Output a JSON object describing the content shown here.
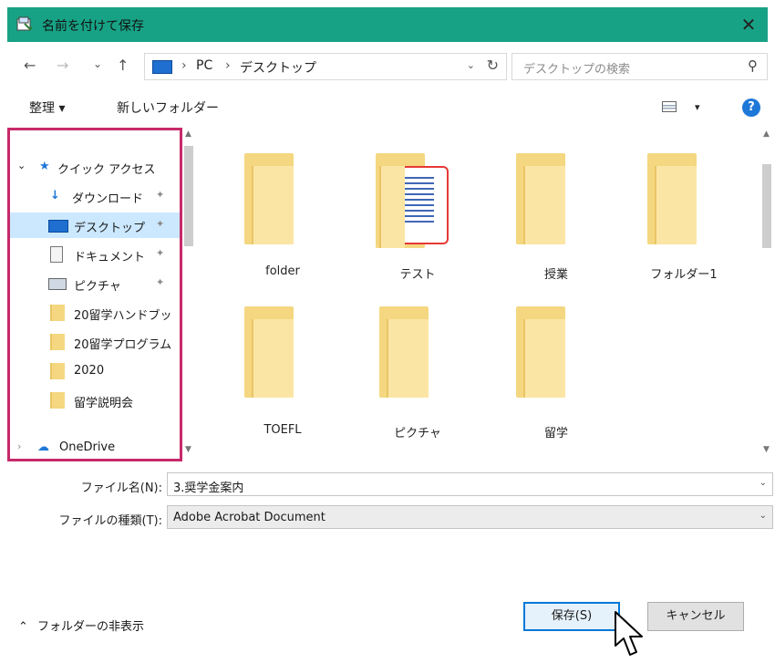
{
  "window": {
    "title": "名前を付けて保存",
    "close": "✕"
  },
  "address": {
    "back": "←",
    "forward": "→",
    "recent": "⌄",
    "up": "↑",
    "crumbs": [
      "PC",
      "デスクトップ"
    ],
    "sep": "›",
    "dropdown": "⌄",
    "refresh": "↻",
    "search_placeholder": "デスクトップの検索",
    "search_icon": "⚲"
  },
  "toolbar": {
    "organize": "整理 ▾",
    "new_folder": "新しいフォルダー",
    "view_dd": "▾",
    "help": "?"
  },
  "nav": {
    "quick_access": "クイック アクセス",
    "items": [
      {
        "label": "ダウンロード",
        "pinned": "✦"
      },
      {
        "label": "デスクトップ",
        "pinned": "✦"
      },
      {
        "label": "ドキュメント",
        "pinned": "✦"
      },
      {
        "label": "ピクチャ",
        "pinned": "✦"
      },
      {
        "label": "20留学ハンドブッ"
      },
      {
        "label": "20留学プログラム"
      },
      {
        "label": "2020"
      },
      {
        "label": "留学説明会"
      }
    ],
    "onedrive": "OneDrive"
  },
  "files": [
    "folder",
    "テスト",
    "授業",
    "フォルダー1",
    "TOEFL",
    "ピクチャ",
    "留学"
  ],
  "form": {
    "filename_label": "ファイル名(N):",
    "filename_value": "3.奨学金案内",
    "filetype_label": "ファイルの種類(T):",
    "filetype_value": "Adobe Acrobat Document",
    "dd": "⌄"
  },
  "footer": {
    "hide_folders": "フォルダーの非表示",
    "hide_arrow": "⌃",
    "save": "保存(S)",
    "cancel": "キャンセル"
  },
  "colors": {
    "titlebar": "#18a285",
    "highlight_border": "#c7296a",
    "selected": "#cce8ff",
    "primary": "#0078d7"
  }
}
